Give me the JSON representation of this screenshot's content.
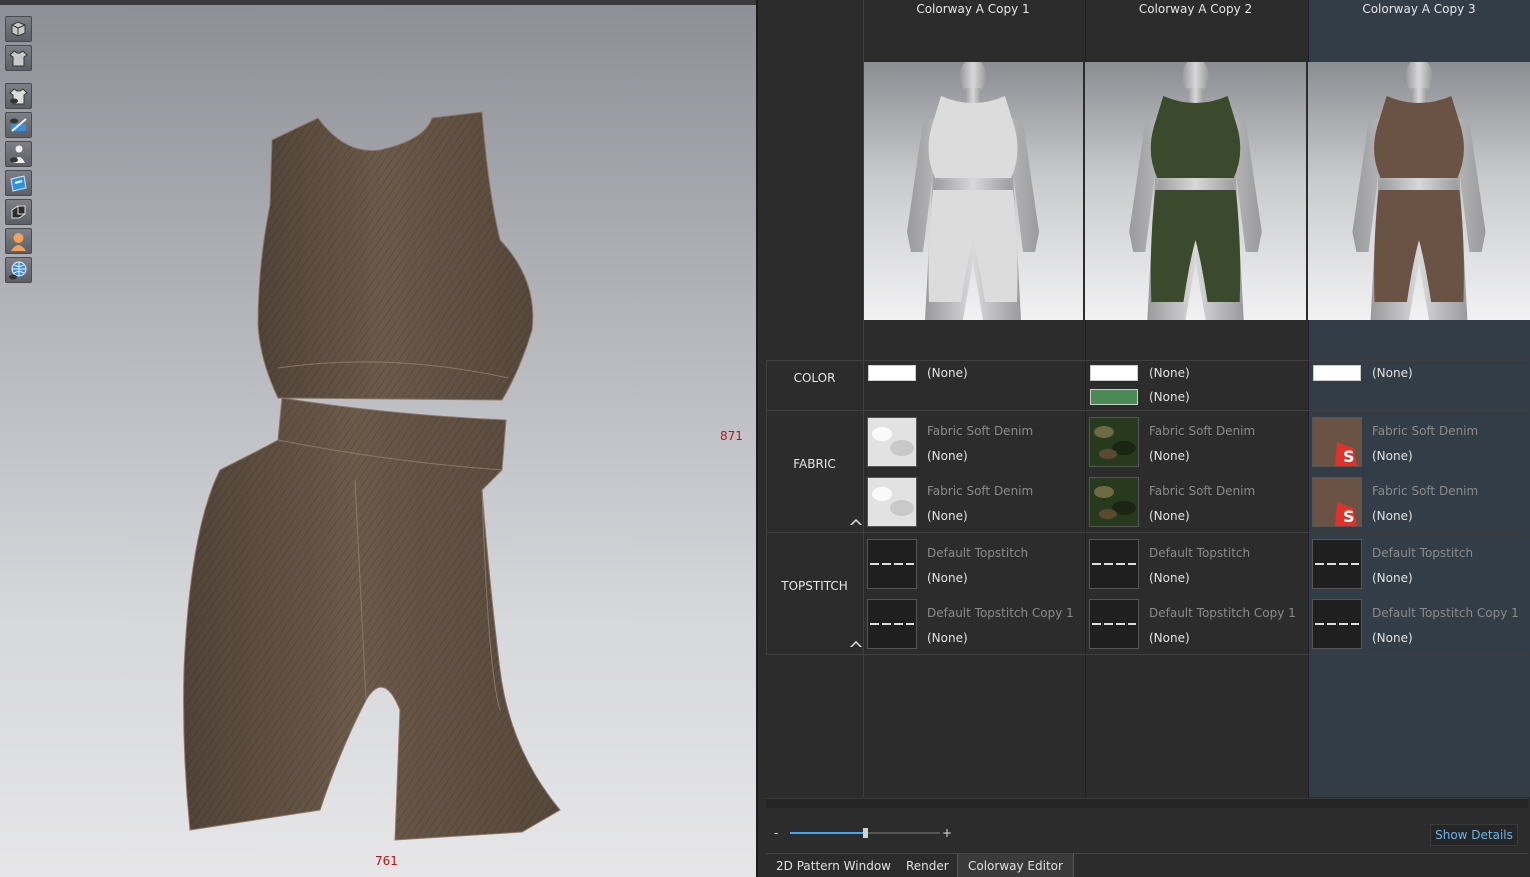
{
  "viewport": {
    "dimension_right": "871",
    "dimension_bottom": "761",
    "toolbar_icons": [
      "render-cube-icon",
      "garment-icon",
      "show-avatar-icon",
      "edit-pattern-icon",
      "avatar-visibility-icon",
      "texture-icon",
      "surface-icon",
      "avatar-skin-icon",
      "globe-icon"
    ]
  },
  "editor": {
    "columns": [
      {
        "title": "Colorway A Copy 1",
        "fabric_color": "#dcdcdc",
        "colors": [
          {
            "swatch": "#ffffff",
            "label": "(None)"
          }
        ],
        "fabrics": [
          {
            "name": "Fabric Soft Denim",
            "value": "(None)"
          },
          {
            "name": "Fabric Soft Denim",
            "value": "(None)"
          }
        ],
        "topstitches": [
          {
            "name": "Default Topstitch",
            "value": "(None)"
          },
          {
            "name": "Default Topstitch Copy 1",
            "value": "(None)"
          }
        ]
      },
      {
        "title": "Colorway A Copy 2",
        "fabric_color": "#3b4a2c",
        "colors": [
          {
            "swatch": "#ffffff",
            "label": "(None)"
          },
          {
            "swatch": "#4c8a55",
            "label": "(None)"
          }
        ],
        "fabrics": [
          {
            "name": "Fabric Soft Denim",
            "value": "(None)"
          },
          {
            "name": "Fabric Soft Denim",
            "value": "(None)"
          }
        ],
        "topstitches": [
          {
            "name": "Default Topstitch",
            "value": "(None)"
          },
          {
            "name": "Default Topstitch Copy 1",
            "value": "(None)"
          }
        ]
      },
      {
        "title": "Colorway A Copy 3",
        "fabric_color": "#6a5345",
        "colors": [
          {
            "swatch": "#ffffff",
            "label": "(None)"
          }
        ],
        "fabrics": [
          {
            "name": "Fabric Soft Denim",
            "value": "(None)"
          },
          {
            "name": "Fabric Soft Denim",
            "value": "(None)"
          }
        ],
        "topstitches": [
          {
            "name": "Default Topstitch",
            "value": "(None)"
          },
          {
            "name": "Default Topstitch Copy 1",
            "value": "(None)"
          }
        ]
      }
    ],
    "sections": {
      "color": "COLOR",
      "fabric": "FABRIC",
      "topstitch": "TOPSTITCH"
    },
    "zoom": {
      "minus": "-",
      "plus": "+",
      "level": 0.5
    },
    "show_details": "Show Details",
    "tabs": [
      "2D Pattern Window",
      "Render",
      "Colorway Editor"
    ],
    "active_tab": "Colorway Editor"
  }
}
